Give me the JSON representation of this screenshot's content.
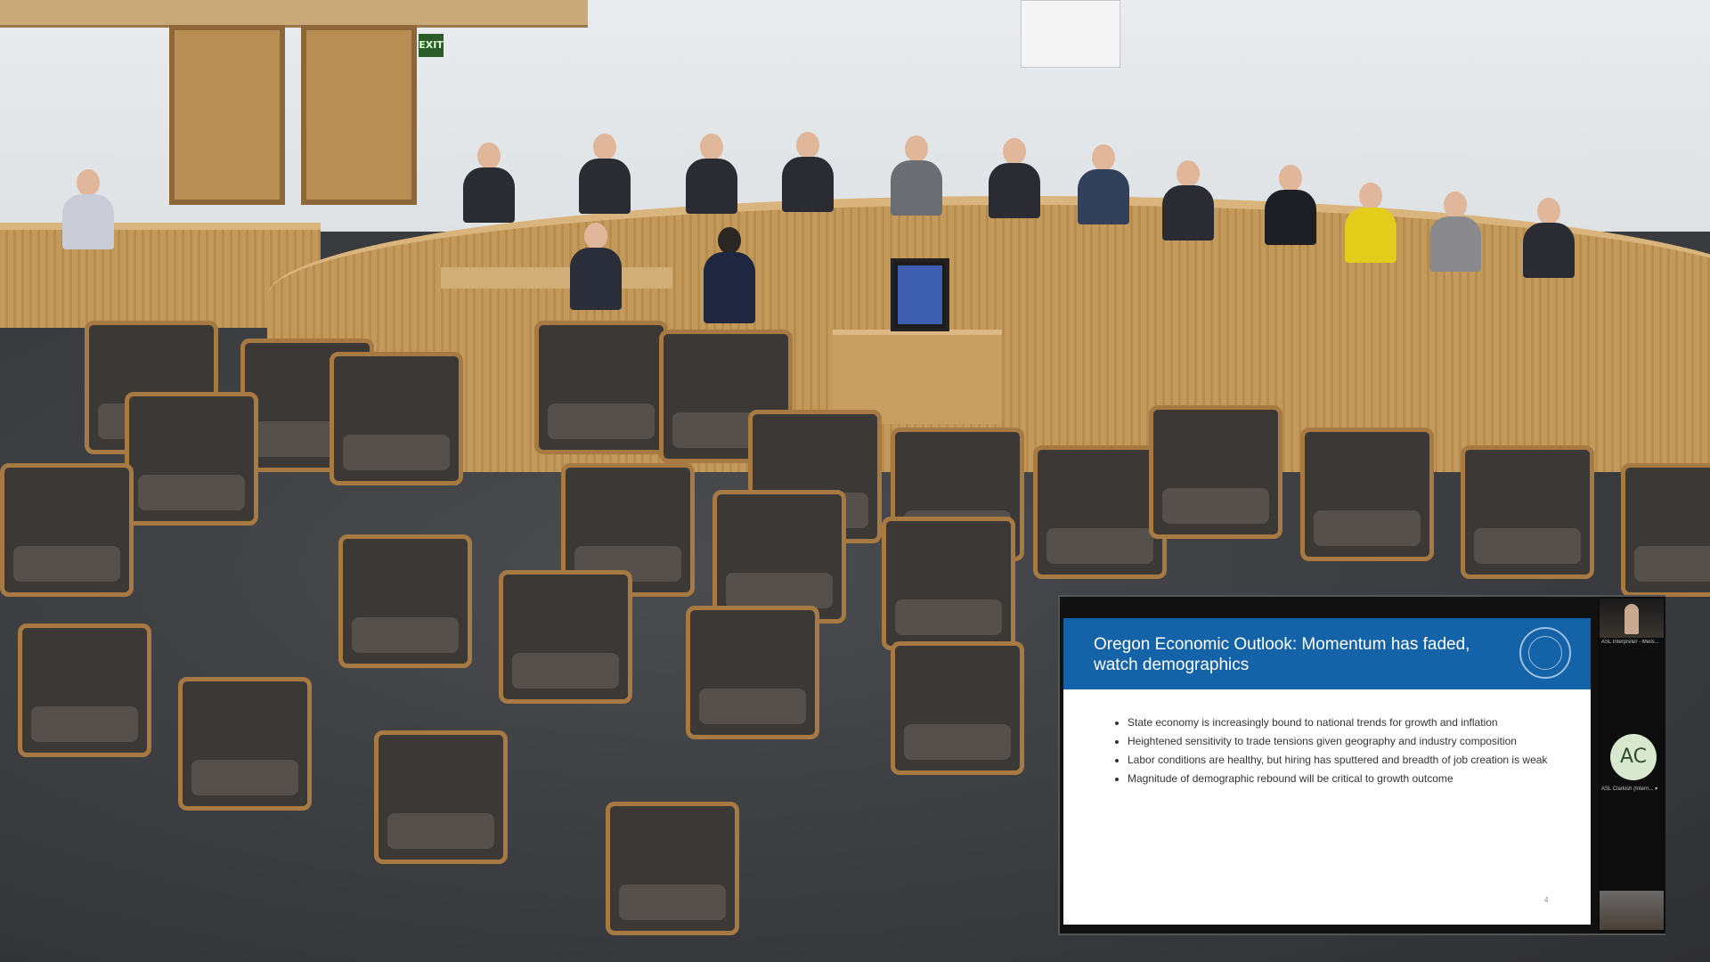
{
  "room": {
    "exit_sign": "EXIT"
  },
  "presentation": {
    "title": "Oregon Economic Outlook: Momentum has faded, watch demographics",
    "bullets": [
      "State economy is increasingly bound to national trends for growth and inflation",
      "Heightened sensitivity to trade tensions given geography and industry composition",
      "Labor conditions are healthy, but hiring has sputtered and breadth of job creation is weak",
      "Magnitude of demographic rebound will be critical to growth outcome"
    ],
    "page_number": "4"
  },
  "participants": {
    "tile1_label": "ASL Interpreter - Melis...",
    "tile2_initials": "AC",
    "tile2_label": "ASL Clarkish (Intern... ▾"
  }
}
